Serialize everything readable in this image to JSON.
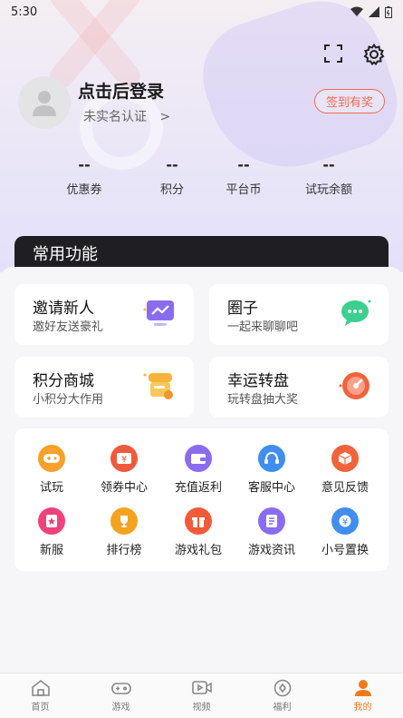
{
  "status": {
    "time": "5:30"
  },
  "profile": {
    "login_title": "点击后登录",
    "realname": "未实名认证",
    "realname_arrow": ">",
    "checkin_label": "签到有奖"
  },
  "stats": [
    {
      "value": "--",
      "label": "优惠券"
    },
    {
      "value": "--",
      "label": "积分"
    },
    {
      "value": "--",
      "label": "平台币"
    },
    {
      "value": "--",
      "label": "试玩余额"
    }
  ],
  "section_title": "常用功能",
  "cards": [
    {
      "title": "邀请新人",
      "subtitle": "邀好友送豪礼",
      "icon": "chart-board-icon"
    },
    {
      "title": "圈子",
      "subtitle": "一起来聊聊吧",
      "icon": "chat-bubble-icon"
    },
    {
      "title": "积分商城",
      "subtitle": "小积分大作用",
      "icon": "store-icon"
    },
    {
      "title": "幸运转盘",
      "subtitle": "玩转盘抽大奖",
      "icon": "wheel-icon"
    }
  ],
  "grid": [
    {
      "label": "试玩",
      "icon": "gamepad-icon",
      "color": "#f7a12b"
    },
    {
      "label": "领券中心",
      "icon": "coupon-icon",
      "color": "#ef5a3c"
    },
    {
      "label": "充值返利",
      "icon": "wallet-icon",
      "color": "#8b6cf0"
    },
    {
      "label": "客服中心",
      "icon": "headset-icon",
      "color": "#3f8ef0"
    },
    {
      "label": "意见反馈",
      "icon": "box-icon",
      "color": "#f0643c"
    },
    {
      "label": "新服",
      "icon": "star-badge-icon",
      "color": "#f0427a"
    },
    {
      "label": "排行榜",
      "icon": "trophy-icon",
      "color": "#f4a320"
    },
    {
      "label": "游戏礼包",
      "icon": "gift-icon",
      "color": "#f35a3a"
    },
    {
      "label": "游戏资讯",
      "icon": "news-icon",
      "color": "#8a6cf0"
    },
    {
      "label": "小号置换",
      "icon": "exchange-icon",
      "color": "#3f8ef0"
    }
  ],
  "tabs": [
    {
      "label": "首页",
      "icon": "home-icon"
    },
    {
      "label": "游戏",
      "icon": "gamepad-icon"
    },
    {
      "label": "视频",
      "icon": "video-icon"
    },
    {
      "label": "福利",
      "icon": "welfare-icon"
    },
    {
      "label": "我的",
      "icon": "profile-icon",
      "active": true
    }
  ],
  "colors": {
    "accent": "#f07a1a",
    "checkin": "#f26b4f",
    "dark_bar": "#1f1f23"
  }
}
